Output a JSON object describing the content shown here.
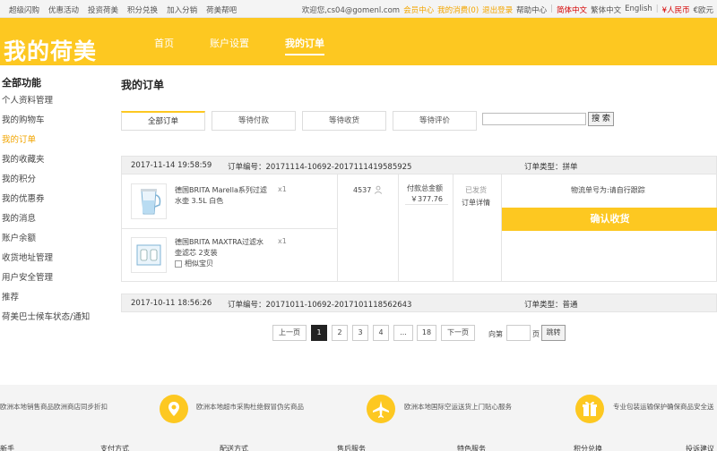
{
  "topbar": {
    "left": [
      "超级闪购",
      "优惠活动",
      "投资荷美",
      "积分兑换",
      "加入分销",
      "荷美帮吧"
    ],
    "welcome": "欢迎您,cs04@gomenl.com",
    "member": "会员中心",
    "my_orders": "我的消费(0)",
    "logout": "退出登录",
    "help": "帮助中心",
    "lang_cn": "简体中文",
    "lang_tw": "繁体中文",
    "lang_en": "English",
    "cur_rmb": "¥人民币",
    "cur_eur": "€欧元"
  },
  "header": {
    "logo": "我的荷美",
    "nav": [
      "首页",
      "账户设置",
      "我的订单"
    ]
  },
  "sidebar": {
    "title": "全部功能",
    "items": [
      "个人资料管理",
      "我的购物车",
      "我的订单",
      "我的收藏夹",
      "我的积分",
      "我的优惠券",
      "我的消息",
      "账户余额",
      "收货地址管理",
      "用户安全管理",
      "推荐",
      "荷美巴士候车状态/通知"
    ]
  },
  "main": {
    "title": "我的订单",
    "tabs": [
      "全部订单",
      "等待付款",
      "等待收货",
      "等待评价"
    ],
    "search_btn": "搜 索"
  },
  "orders": [
    {
      "date": "2017-11-14 19:58:59",
      "number": "订单编号：20171114-10692-2017111419585925",
      "type": "订单类型：拼单",
      "products": [
        {
          "name": "德国BRITA Marella系列过滤水壶 3.5L 白色",
          "qty": "x1"
        },
        {
          "name": "德国BRITA MAXTRA过滤水壶滤芯 2支装",
          "qty": "x1",
          "similar": "相似宝贝"
        }
      ],
      "id": "4537",
      "total_label": "付款总金额",
      "total": "￥377.76",
      "status": "已发货",
      "detail": "订单详情",
      "logistics": "物流单号为:请自行跟踪",
      "confirm": "确认收货"
    },
    {
      "date": "2017-10-11 18:56:26",
      "number": "订单编号：20171011-10692-2017101118562643",
      "type": "订单类型：普通"
    }
  ],
  "pager": {
    "prev": "上一页",
    "pages": [
      "1",
      "2",
      "3",
      "4",
      "...",
      "18"
    ],
    "next": "下一页",
    "goto_label": "向第",
    "page_unit": "页",
    "jump": "跳转"
  },
  "footer": {
    "features": [
      "欧洲本地销售商品欧洲商店同步折扣",
      "欧洲本地超市采购杜绝假冒伪劣商品",
      "欧洲本地国际空运送货上门贴心服务",
      "专业包装运输保护确保商品安全送"
    ],
    "links": [
      "新手",
      "支付方式",
      "配送方式",
      "售后服务",
      "特色服务",
      "积分兑换",
      "投诉建议"
    ]
  },
  "colors": {
    "brand": "#fdc821",
    "accent_text": "#f2a500",
    "dark": "#222222"
  }
}
